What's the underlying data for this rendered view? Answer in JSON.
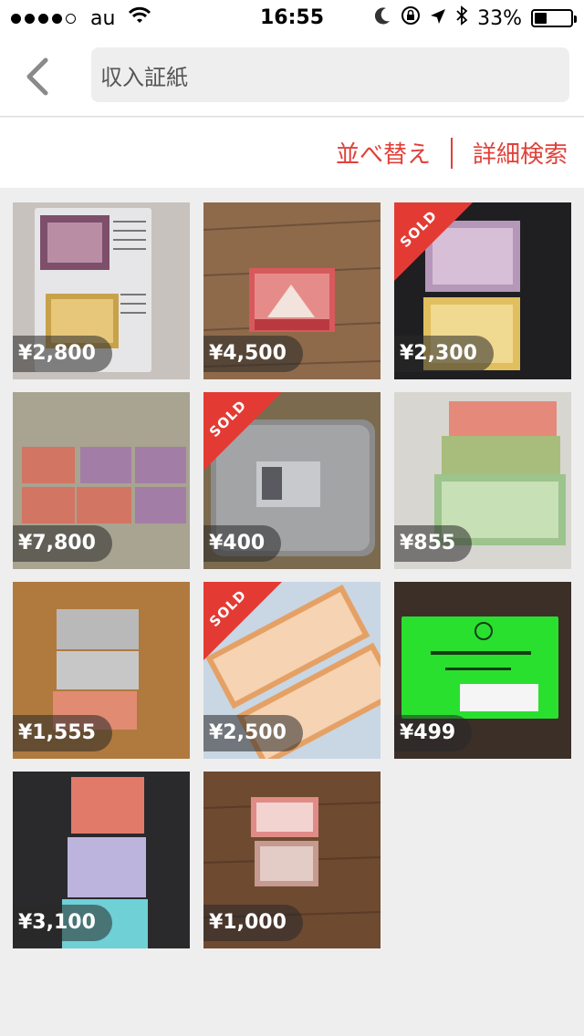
{
  "status_bar": {
    "carrier": "au",
    "time": "16:55",
    "battery": "33%",
    "battery_level": 0.33
  },
  "search": {
    "query": "収入証紙"
  },
  "filter": {
    "sort_label": "並べ替え",
    "detail_label": "詳細検索"
  },
  "sold_label": "SOLD",
  "items": [
    {
      "price": "¥2,800",
      "sold": false
    },
    {
      "price": "¥4,500",
      "sold": false
    },
    {
      "price": "¥2,300",
      "sold": true
    },
    {
      "price": "¥7,800",
      "sold": false
    },
    {
      "price": "¥400",
      "sold": true
    },
    {
      "price": "¥855",
      "sold": false
    },
    {
      "price": "¥1,555",
      "sold": false
    },
    {
      "price": "¥2,500",
      "sold": true
    },
    {
      "price": "¥499",
      "sold": false
    },
    {
      "price": "¥3,100",
      "sold": false
    },
    {
      "price": "¥1,000",
      "sold": false
    }
  ],
  "colors": {
    "accent": "#e0413a",
    "sold_ribbon": "#e33b34"
  }
}
